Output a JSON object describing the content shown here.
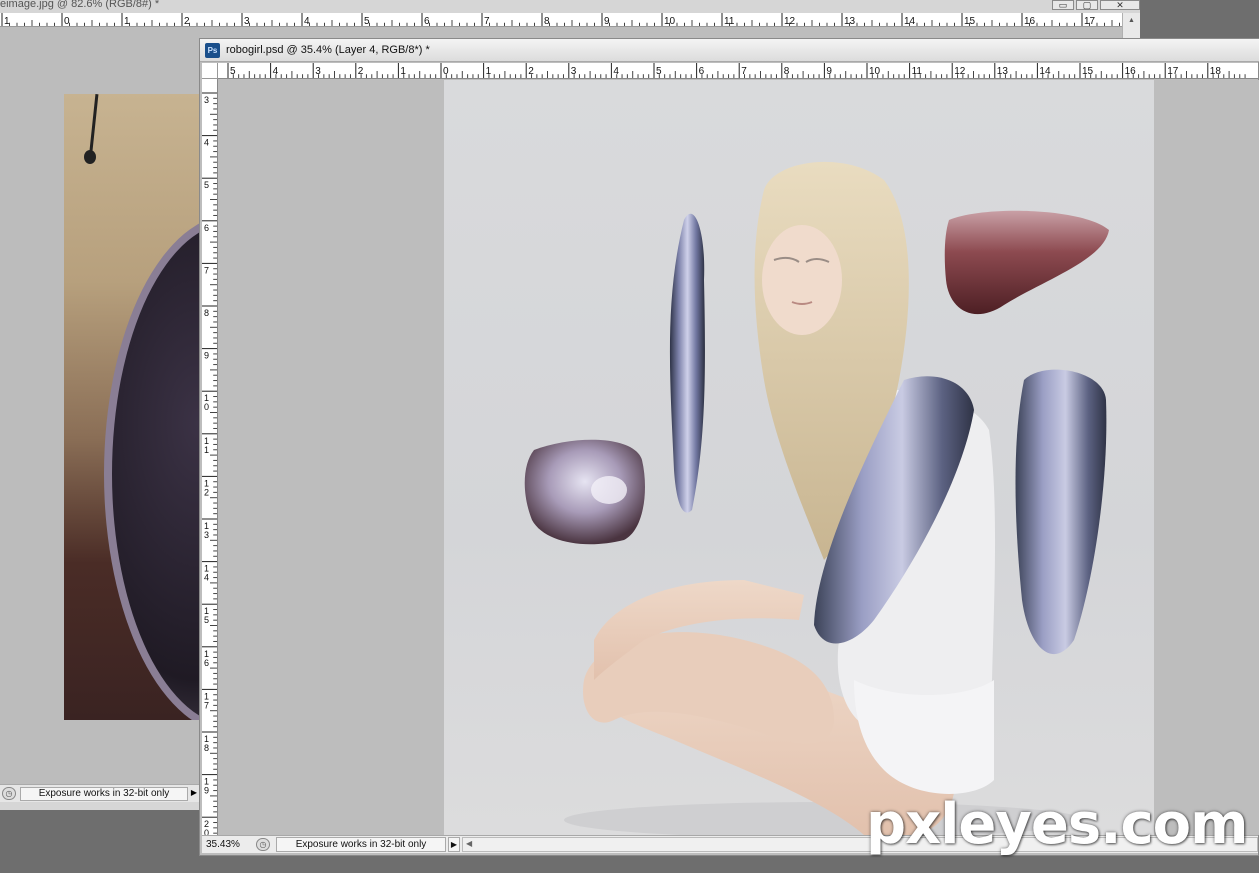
{
  "back_window": {
    "title": "eimage.jpg @ 82.6% (RGB/8#) *",
    "buttons": {
      "minimize": "▭",
      "maximize": "▢",
      "close": "✕"
    },
    "ruler_labels": [
      "1",
      "0",
      "1",
      "2",
      "3",
      "4",
      "5",
      "6",
      "7",
      "8",
      "9",
      "10",
      "11",
      "12",
      "13",
      "14",
      "15",
      "16",
      "17"
    ],
    "status_message": "Exposure works in 32-bit only"
  },
  "front_window": {
    "app_icon": "Ps",
    "title": "robogirl.psd @ 35.4% (Layer 4, RGB/8*) *",
    "ruler_h_labels": [
      "5",
      "4",
      "3",
      "2",
      "1",
      "0",
      "1",
      "2",
      "3",
      "4",
      "5",
      "6",
      "7",
      "8",
      "9",
      "10",
      "11",
      "12",
      "13",
      "14",
      "15",
      "16",
      "17",
      "18"
    ],
    "ruler_v_labels": [
      "3",
      "4",
      "5",
      "6",
      "7",
      "8",
      "9",
      "1 0",
      "1 1",
      "1 2",
      "1 3",
      "1 4",
      "1 5",
      "1 6",
      "1 7",
      "1 8",
      "1 9",
      "2 0"
    ],
    "status": {
      "zoom": "35.43%",
      "message": "Exposure works in 32-bit only"
    }
  },
  "watermark": "pxleyes.com",
  "colors": {
    "workspace": "#6e6e6e",
    "canvas_bg": "#bdbdbd",
    "photo_bg": "#d6d7d9",
    "chrome_blue": "#6c6f9a",
    "chrome_red": "#7a3a3e"
  }
}
